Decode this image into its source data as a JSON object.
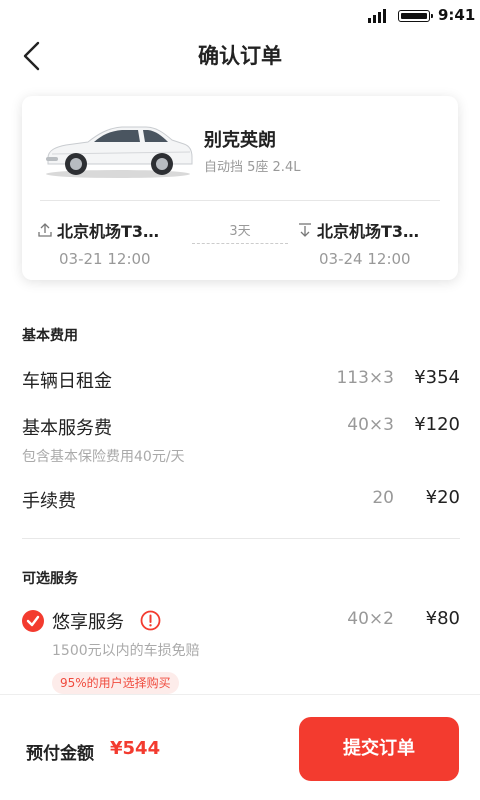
{
  "status_bar": {
    "time": "9:41"
  },
  "nav": {
    "title": "确认订单"
  },
  "car": {
    "name": "别克英朗",
    "spec": "自动挡 5座 2.4L",
    "pickup": {
      "location": "北京机场T3…",
      "time": "03-21 12:00"
    },
    "return": {
      "location": "北京机场T3…",
      "time": "03-24 12:00"
    },
    "duration": "3天"
  },
  "basic_fees": {
    "title": "基本费用",
    "items": [
      {
        "name": "车辆日租金",
        "calc": "113×3",
        "amount": "¥354"
      },
      {
        "name": "基本服务费",
        "calc": "40×3",
        "amount": "¥120",
        "note": "包含基本保险费用40元/天"
      },
      {
        "name": "手续费",
        "calc": "20",
        "amount": "¥20"
      }
    ]
  },
  "optional_services": {
    "title": "可选服务",
    "items": [
      {
        "name": "悠享服务",
        "calc": "40×2",
        "amount": "¥80",
        "description": "1500元以内的车损免赔",
        "badge": "95%的用户选择购买",
        "checked": true
      }
    ]
  },
  "footer": {
    "prepay_label": "预付金额",
    "prepay_amount": "¥544",
    "submit_label": "提交订单"
  },
  "colors": {
    "accent": "#f33b2f",
    "muted": "#999999"
  },
  "icons": [
    "back-icon",
    "signal-icon",
    "battery-icon",
    "pickup-icon",
    "return-icon",
    "check-icon",
    "info-icon"
  ]
}
